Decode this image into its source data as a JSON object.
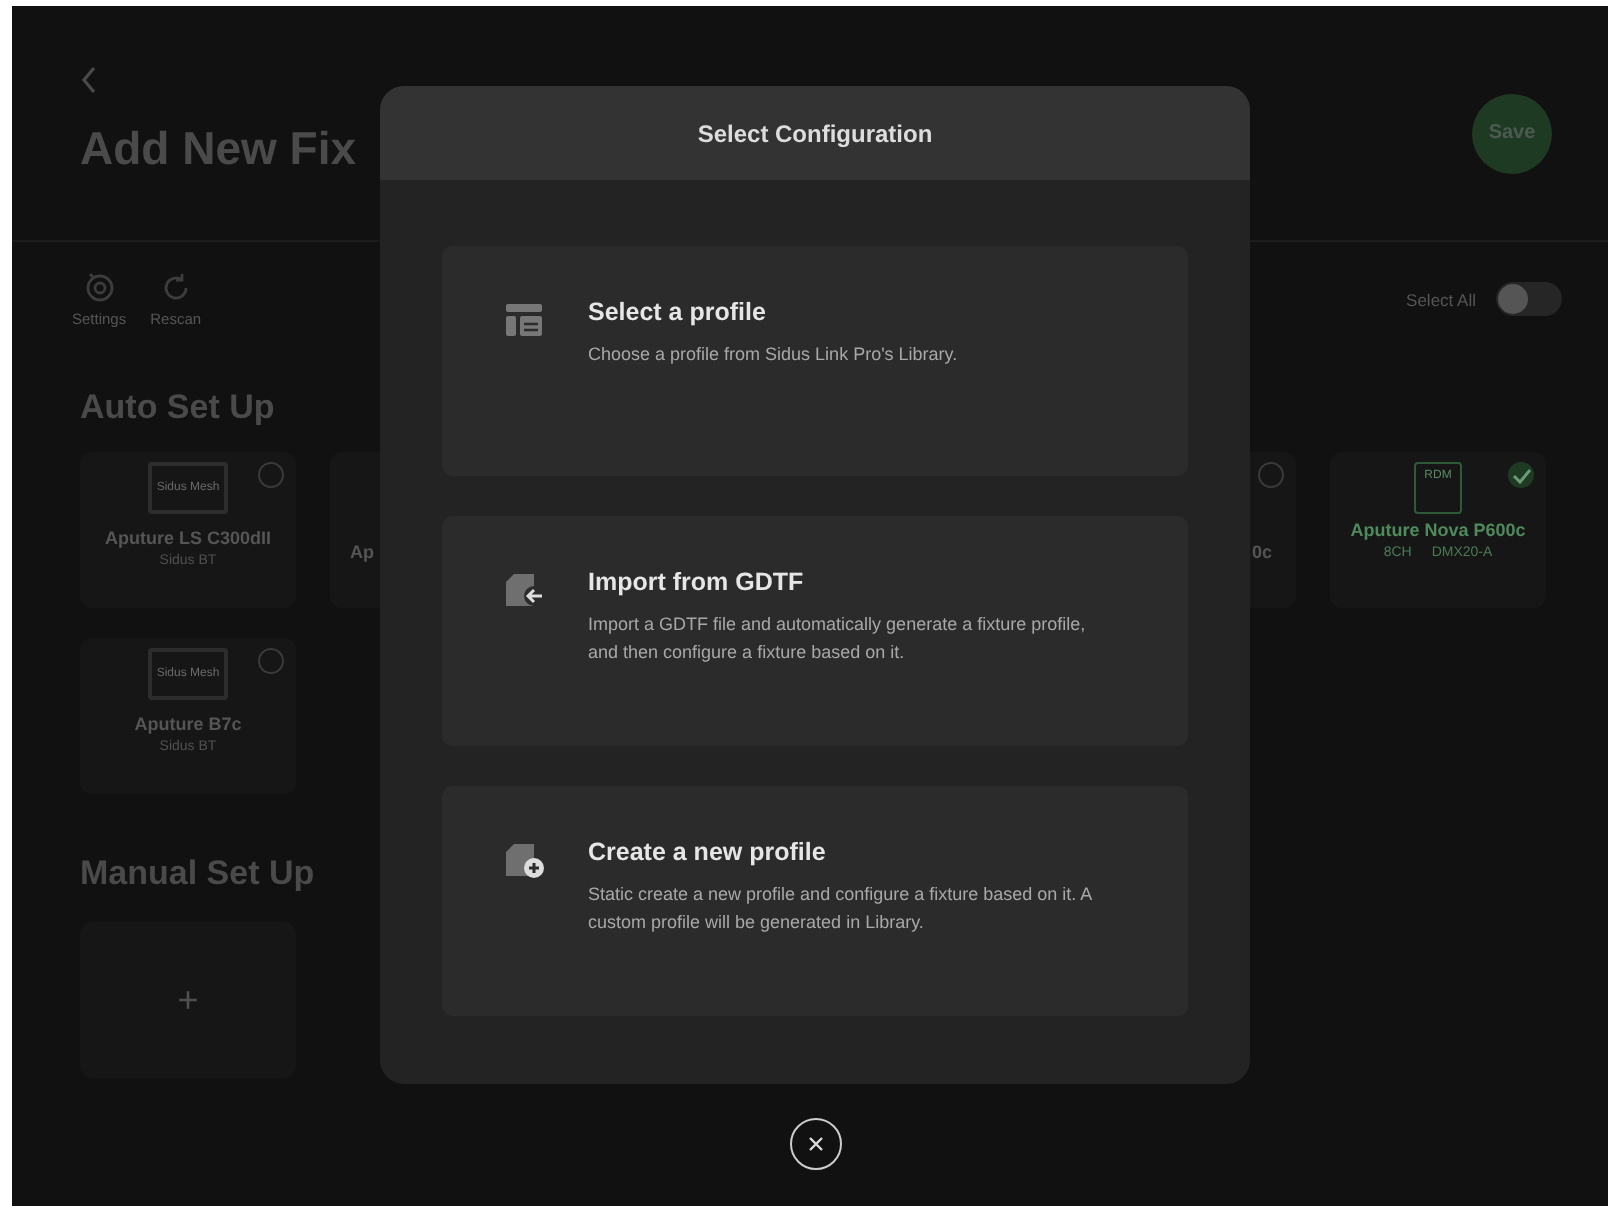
{
  "page": {
    "title": "Add New Fix",
    "save_button": "Save",
    "toolbar": [
      {
        "kind": "settings",
        "label": "Settings"
      },
      {
        "kind": "rescan",
        "label": "Rescan"
      }
    ],
    "select_all": {
      "label": "Select All",
      "on": false
    },
    "auto_heading": "Auto Set Up",
    "fixtures": [
      {
        "kind": "panel",
        "name": "Aputure LS C300dII",
        "screen_label": "Sidus Mesh",
        "details": [
          "Sidus BT"
        ],
        "selected": false
      },
      {
        "kind": "partial_right",
        "name": "Ap"
      },
      {
        "kind": "partial_left",
        "name": "0c",
        "selected": false
      },
      {
        "kind": "rdm",
        "name": "Aputure Nova P600c",
        "screen_label": "RDM",
        "details": [
          "8CH",
          "DMX20-A"
        ],
        "selected": true
      },
      {
        "kind": "panel",
        "name": "Aputure B7c",
        "screen_label": "Sidus Mesh",
        "details": [
          "Sidus BT"
        ],
        "selected": false
      }
    ],
    "manual_heading": "Manual Set Up",
    "add_symbol": "+"
  },
  "dialog": {
    "title": "Select Configuration",
    "options": [
      {
        "kind": "profile",
        "title": "Select a profile",
        "description": "Choose a profile from Sidus Link Pro's Library."
      },
      {
        "kind": "import",
        "title": "Import from GDTF",
        "description": "Import a GDTF file and automatically generate a fixture profile, and then configure a fixture based on it."
      },
      {
        "kind": "create",
        "title": "Create a new profile",
        "description": "Static create a new profile and configure a fixture based on it. A custom profile will be generated in Library."
      }
    ]
  }
}
